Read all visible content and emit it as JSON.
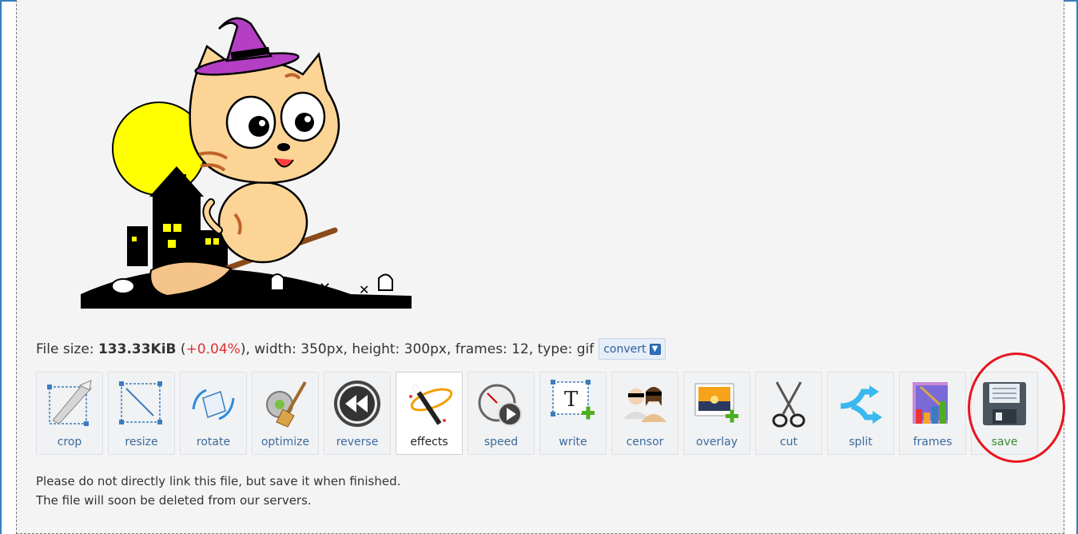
{
  "file_info": {
    "label_size": "File size:",
    "size": "133.33KiB",
    "delta_open": "(",
    "delta": "+0.04%",
    "delta_close": ")",
    "rest": ", width: 350px, height: 300px, frames: 12, type: gif",
    "convert_label": "convert"
  },
  "tools": [
    {
      "label": "crop",
      "icon": "crop-icon"
    },
    {
      "label": "resize",
      "icon": "resize-icon"
    },
    {
      "label": "rotate",
      "icon": "rotate-icon"
    },
    {
      "label": "optimize",
      "icon": "optimize-icon"
    },
    {
      "label": "reverse",
      "icon": "reverse-icon"
    },
    {
      "label": "effects",
      "icon": "effects-icon",
      "active": true
    },
    {
      "label": "speed",
      "icon": "speed-icon"
    },
    {
      "label": "write",
      "icon": "write-icon"
    },
    {
      "label": "censor",
      "icon": "censor-icon"
    },
    {
      "label": "overlay",
      "icon": "overlay-icon"
    },
    {
      "label": "cut",
      "icon": "scissors-icon"
    },
    {
      "label": "split",
      "icon": "split-icon"
    },
    {
      "label": "frames",
      "icon": "frames-icon"
    },
    {
      "label": "save",
      "icon": "floppy-disk-icon"
    }
  ],
  "note": {
    "line1": "Please do not directly link this file, but save it when finished.",
    "line2": "The file will soon be deleted from our servers."
  },
  "colors": {
    "accent_blue": "#3a7dbf",
    "label_blue": "#3c6b9c",
    "delta_red": "#e03030",
    "save_green": "#3a8a2e",
    "highlight_red": "#e8141e"
  }
}
